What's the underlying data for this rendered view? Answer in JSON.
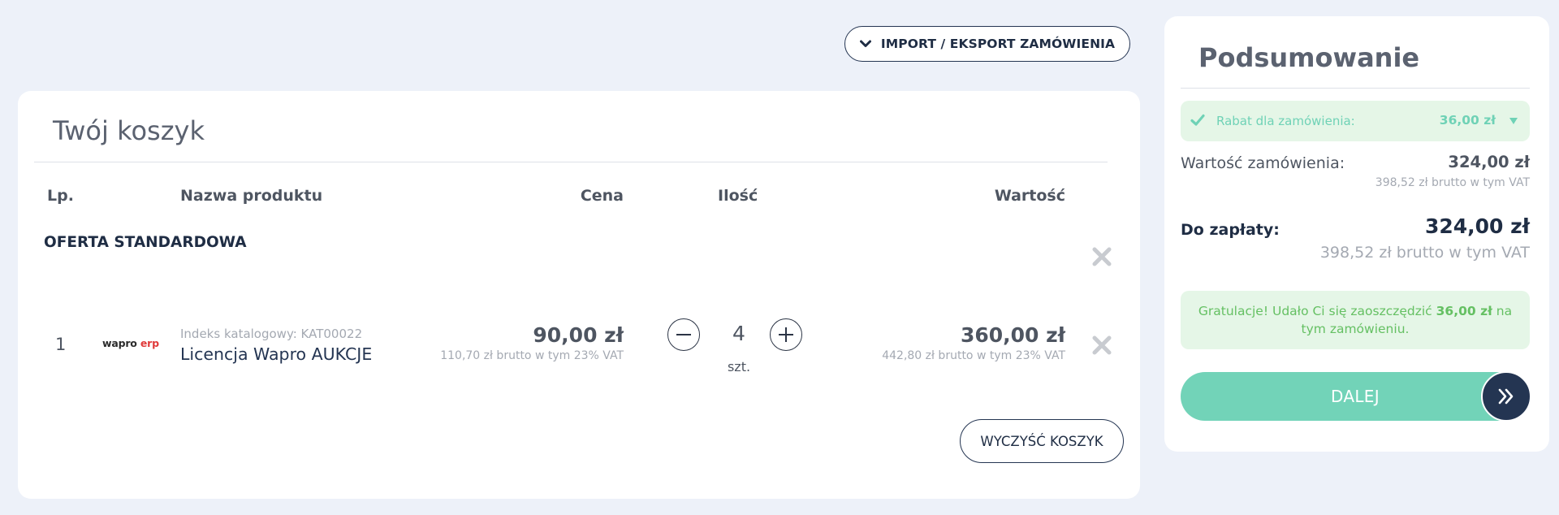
{
  "toolbar": {
    "import_export_label": "IMPORT / EKSPORT ZAMÓWIENIA"
  },
  "cart": {
    "title": "Twój koszyk",
    "columns": {
      "lp": "Lp.",
      "name": "Nazwa produktu",
      "price": "Cena",
      "qty": "Ilość",
      "value": "Wartość"
    },
    "section_title": "OFERTA STANDARDOWA",
    "items": [
      {
        "lp": "1",
        "logo_text_1": "wapro",
        "logo_text_2": "erp",
        "catalog": "Indeks katalogowy: KAT00022",
        "name": "Licencja Wapro AUKCJE",
        "price": "90,00 zł",
        "price_gross": "110,70 zł brutto w tym 23% VAT",
        "qty": "4",
        "unit": "szt.",
        "value": "360,00 zł",
        "value_gross": "442,80 zł brutto w tym 23% VAT"
      }
    ],
    "clear_label": "WYCZYŚĆ KOSZYK"
  },
  "summary": {
    "title": "Podsumowanie",
    "discount_label": "Rabat dla zamówienia:",
    "discount_amount": "36,00 zł",
    "order_value_label": "Wartość zamówienia:",
    "order_value_amount": "324,00 zł",
    "order_value_gross": "398,52 zł brutto w tym VAT",
    "pay_label": "Do zapłaty:",
    "pay_amount": "324,00 zł",
    "pay_gross": "398,52 zł brutto w tym VAT",
    "congrats_pre": "Gratulacje! Udało Ci się zaoszczędzić ",
    "congrats_amount": "36,00 zł",
    "congrats_post": " na tym zamówieniu.",
    "next_label": "DALEJ"
  },
  "colors": {
    "background": "#edf1f9",
    "navy": "#243552",
    "accent_teal": "#72d3b8",
    "success_bg": "#e5f6e7",
    "success_text": "#65c063",
    "remove_icon": "#c8cbd0"
  }
}
